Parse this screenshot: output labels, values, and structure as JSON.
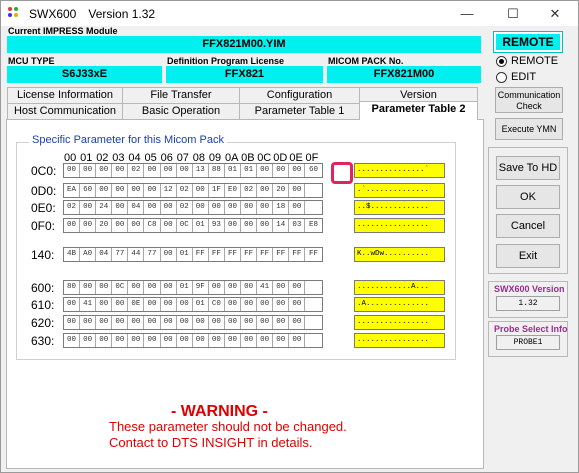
{
  "window": {
    "app_name": "SWX600",
    "version_label": "Version  1.32",
    "minimize": "—",
    "maximize": "☐",
    "close": "✕"
  },
  "current_module": {
    "label": "Current IMPRESS Module",
    "value": "FFX821M00.YIM"
  },
  "mcu_type": {
    "label": "MCU TYPE",
    "value": "S6J33xE"
  },
  "def_program": {
    "label": "Definition Program License",
    "value": "FFX821"
  },
  "micom_pack": {
    "label": "MICOM PACK No.",
    "value": "FFX821M00"
  },
  "tabs_row1": [
    "License Information",
    "File Transfer",
    "Configuration",
    "Version"
  ],
  "tabs_row2": [
    "Host Communication",
    "Basic Operation",
    "Parameter Table 1",
    "Parameter Table 2"
  ],
  "group_title": "Specific Parameter for this Micom Pack",
  "col_headers": [
    "00",
    "01",
    "02",
    "03",
    "04",
    "05",
    "06",
    "07",
    "08",
    "09",
    "0A",
    "0B",
    "0C",
    "0D",
    "0E",
    "0F"
  ],
  "rows": [
    {
      "label": "0C0:",
      "cells": [
        "00",
        "00",
        "00",
        "00",
        "02",
        "00",
        "00",
        "00",
        "13",
        "88",
        "01",
        "01",
        "00",
        "00",
        "00",
        "60"
      ],
      "ascii": "...............`"
    },
    {
      "label": "0D0:",
      "cells": [
        "EA",
        "60",
        "00",
        "00",
        "00",
        "00",
        "12",
        "02",
        "00",
        "1F",
        "E0",
        "02",
        "00",
        "20",
        "00",
        ""
      ],
      "ascii": ".`.............."
    },
    {
      "label": "0E0:",
      "cells": [
        "02",
        "00",
        "24",
        "00",
        "04",
        "00",
        "00",
        "02",
        "00",
        "00",
        "00",
        "00",
        "00",
        "18",
        "00",
        ""
      ],
      "ascii": "..$............."
    },
    {
      "label": "0F0:",
      "cells": [
        "00",
        "00",
        "20",
        "00",
        "00",
        "C8",
        "00",
        "0C",
        "01",
        "93",
        "00",
        "00",
        "00",
        "14",
        "03",
        "E8"
      ],
      "ascii": "................"
    },
    {
      "label": "140:",
      "cells": [
        "4B",
        "A0",
        "04",
        "77",
        "44",
        "77",
        "00",
        "01",
        "FF",
        "FF",
        "FF",
        "FF",
        "FF",
        "FF",
        "FF",
        "FF"
      ],
      "ascii": "K..wDw.........."
    },
    {
      "label": "600:",
      "cells": [
        "80",
        "00",
        "00",
        "0C",
        "00",
        "00",
        "00",
        "01",
        "9F",
        "00",
        "00",
        "00",
        "41",
        "00",
        "00",
        ""
      ],
      "ascii": "............A..."
    },
    {
      "label": "610:",
      "cells": [
        "00",
        "41",
        "00",
        "00",
        "0E",
        "00",
        "00",
        "00",
        "01",
        "C0",
        "00",
        "00",
        "00",
        "00",
        "00",
        ""
      ],
      "ascii": ".A.............."
    },
    {
      "label": "620:",
      "cells": [
        "00",
        "00",
        "00",
        "00",
        "00",
        "00",
        "00",
        "00",
        "00",
        "00",
        "00",
        "00",
        "00",
        "00",
        "00",
        ""
      ],
      "ascii": "................"
    },
    {
      "label": "630:",
      "cells": [
        "00",
        "00",
        "00",
        "00",
        "00",
        "00",
        "00",
        "00",
        "00",
        "00",
        "00",
        "00",
        "00",
        "00",
        "00",
        ""
      ],
      "ascii": "................"
    }
  ],
  "warning": {
    "title": "- WARNING -",
    "line1": "These parameter should not be changed.",
    "line2": "Contact to DTS INSIGHT in details."
  },
  "side": {
    "remote_title": "REMOTE",
    "radio_remote": "REMOTE",
    "radio_edit": "EDIT",
    "comm_check": "Communication Check",
    "execute": "Execute YMN",
    "save": "Save To HD",
    "ok": "OK",
    "cancel": "Cancel",
    "exit": "Exit",
    "ver_label": "SWX600 Version",
    "ver_value": "1.32",
    "probe_label": "Probe Select Info",
    "probe_value": "PROBE1"
  },
  "colors": {
    "cyan": "#00f0f0",
    "ascii_bg": "#ffff00",
    "warning": "#e00000",
    "highlight": "#e0245e"
  }
}
